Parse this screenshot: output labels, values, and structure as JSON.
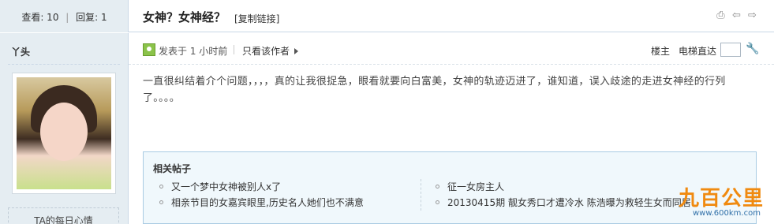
{
  "header": {
    "views_label": "查看: 10",
    "replies_label": "回复: 1",
    "separator": "|",
    "title": "女神？女神经？",
    "copy_link": "[复制链接]",
    "icons": [
      "print-icon",
      "prev-thread-icon",
      "next-thread-icon"
    ]
  },
  "user": {
    "name": "丫头",
    "mood_label": "TA的每日心情"
  },
  "post": {
    "posted_time": "发表于 1 小时前",
    "only_author": "只看该作者",
    "floor": "楼主",
    "elevator": "电梯直达",
    "elevator_value": "",
    "body": "一直很纠结着介个问题，，，，真的让我很捉急，眼看就要向白富美，女神的轨迹迈进了，谁知道，误入歧途的走进女神经的行列了。。。。"
  },
  "related": {
    "title": "相关帖子",
    "col1": [
      "又一个梦中女神被别人x了",
      "相亲节目的女嘉宾眼里,历史名人她们也不满意"
    ],
    "col2": [
      "征一女房主人",
      "20130415期 靓女秀口才遭冷水 陈浩曝为救轻生女而同居"
    ]
  },
  "watermark": {
    "text": "九百公里",
    "url": "www.600km.com"
  },
  "colors": {
    "sidebar_bg": "#e5edf2",
    "border": "#c9d7e6",
    "related_bg": "#f0f8fc",
    "watermark_orange": "#f08a10",
    "watermark_blue": "#2f6fa8"
  }
}
